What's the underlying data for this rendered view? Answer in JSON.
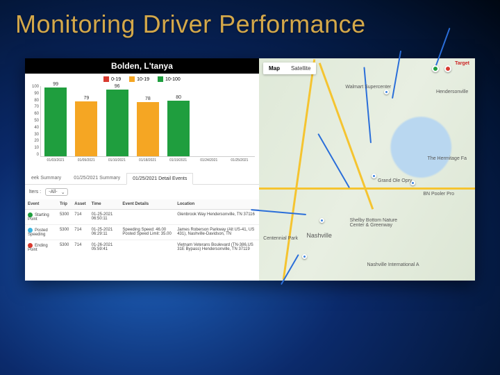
{
  "title": "Monitoring Driver Performance",
  "chart_data": {
    "type": "bar",
    "title": "Bolden, L'tanya",
    "legend": [
      {
        "label": "0-19",
        "color": "#d83a2f"
      },
      {
        "label": "10-19",
        "color": "#f5a623"
      },
      {
        "label": "10-100",
        "color": "#1f9e3e"
      }
    ],
    "categories": [
      "01/03/2021",
      "01/09/2021",
      "01/10/2021",
      "01/18/2021",
      "01/19/2021",
      "01/24/2021",
      "01/25/2021"
    ],
    "values": [
      99,
      79,
      96,
      78,
      80,
      null,
      null
    ],
    "colors": [
      "#1f9e3e",
      "#f5a623",
      "#1f9e3e",
      "#f5a623",
      "#1f9e3e",
      "",
      ""
    ],
    "y_ticks": [
      "100",
      "90",
      "80",
      "70",
      "60",
      "50",
      "40",
      "30",
      "20",
      "10",
      "0"
    ],
    "ylim": [
      0,
      100
    ]
  },
  "tabs": {
    "items": [
      "eek Summary",
      "01/25/2021 Summary",
      "01/25/2021 Detail Events"
    ],
    "active_index": 2
  },
  "filter": {
    "label": "lters :",
    "selected": "-All-"
  },
  "table": {
    "headers": [
      "Event",
      "Trip",
      "Asset",
      "Time",
      "Event Details",
      "Location"
    ],
    "rows": [
      {
        "dot": "#1f9e3e",
        "event": "Starting Point",
        "trip": "5300",
        "asset": "714",
        "time": "01-25-2021 06:50:11",
        "details": "",
        "location": "Glenbrook Way Hendersonville, TN 37116"
      },
      {
        "dot": "#3bb5e0",
        "event": "Posted Speeding",
        "trip": "5300",
        "asset": "714",
        "time": "01-25-2021 06:29:11",
        "details": "Speeding  Speed: 46.00 Posted Speed Limit: 35.00",
        "location": "James Roberson Parkway (Alt US-41, US 431), Nashville-Davidson, TN"
      },
      {
        "dot": "#d83a2f",
        "event": "Ending Point",
        "trip": "5300",
        "asset": "714",
        "time": "01-26-2021 05:59:41",
        "details": "",
        "location": "Vietnam Veterans Boulevard (TN-386,US 31E Bypass) Hendersonville, TN 37119"
      }
    ]
  },
  "map": {
    "controls": {
      "map": "Map",
      "satellite": "Satellite"
    },
    "target": "Target",
    "labels": {
      "walmart": "Walmart Supercenter",
      "nashville": "Nashville",
      "grandole": "Grand Ole Opry",
      "hermitage": "The Hermitage Fa",
      "centennial": "Centennial Park",
      "shelby": "Shelby Bottom Nature Center & Greenway",
      "hendersonville": "Hendersonville",
      "poole": "BN Pooler Pro",
      "intl": "Nashville International A"
    }
  }
}
